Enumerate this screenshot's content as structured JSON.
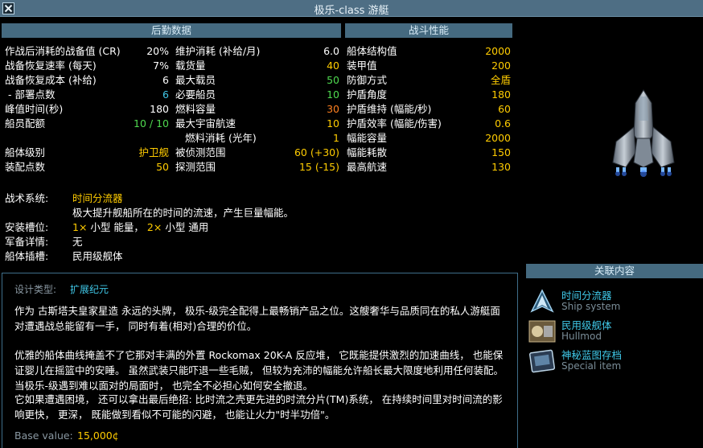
{
  "title": "极乐-class 游艇",
  "logistics": {
    "header": "后勤数据",
    "col1": [
      {
        "label": "作战后消耗的战备值 (CR)",
        "value": "20%",
        "color": "w"
      },
      {
        "label": "战备恢复速率 (每天)",
        "value": "7%",
        "color": "w"
      },
      {
        "label": "战备恢复成本 (补给)",
        "value": "6",
        "color": "w"
      },
      {
        "label": "- 部署点数",
        "value": "6",
        "color": "c"
      },
      {
        "label": "峰值时间(秒)",
        "value": "180",
        "color": "w"
      },
      {
        "label": "船员配额",
        "value": "10 / 10",
        "color": "g"
      },
      {
        "label": "",
        "value": "",
        "color": "w"
      },
      {
        "label": "船体级别",
        "value": "护卫舰",
        "color": "y"
      },
      {
        "label": "装配点数",
        "value": "50",
        "color": "y"
      }
    ],
    "col2": [
      {
        "label": "维护消耗 (补给/月)",
        "value": "6.0",
        "color": "w"
      },
      {
        "label": "载货量",
        "value": "40",
        "color": "y"
      },
      {
        "label": "最大载员",
        "value": "50",
        "color": "g"
      },
      {
        "label": "必要船员",
        "value": "10",
        "color": "g"
      },
      {
        "label": "燃料容量",
        "value": "30",
        "color": "o"
      },
      {
        "label": "最大宇宙航速",
        "value": "10",
        "color": "y"
      },
      {
        "label": "燃料消耗 (光年)",
        "value": "1",
        "color": "y"
      },
      {
        "label": "被侦测范围",
        "value": "60 (+30)",
        "color": "y"
      },
      {
        "label": "探测范围",
        "value": "15 (-15)",
        "color": "y"
      }
    ]
  },
  "combat": {
    "header": "战斗性能",
    "rows": [
      {
        "label": "船体结构值",
        "value": "2000"
      },
      {
        "label": "装甲值",
        "value": "200"
      },
      {
        "label": "防御方式",
        "value": "全盾"
      },
      {
        "label": "护盾角度",
        "value": "180"
      },
      {
        "label": "护盾维持 (幅能/秒)",
        "value": "60"
      },
      {
        "label": "护盾效率 (幅能/伤害)",
        "value": "0.6"
      },
      {
        "label": "幅能容量",
        "value": "2000"
      },
      {
        "label": "幅能耗散",
        "value": "150"
      },
      {
        "label": "最高航速",
        "value": "130"
      }
    ]
  },
  "systems": {
    "tactical_label": "战术系统:",
    "tactical_name": "时间分流器",
    "tactical_desc": "极大提升舰船所在的时间的流速，产生巨量幅能。",
    "slots_label": "安装槽位:",
    "slots_n1": "1×",
    "slots_t1": "小型 能量，",
    "slots_n2": "2×",
    "slots_t2": "小型 通用",
    "armament_label": "军备详情:",
    "armament_value": "无",
    "hullmod_label": "船体插槽:",
    "hullmod_value": "民用级舰体"
  },
  "description": {
    "type_label": "设计类型:",
    "type_value": "扩展纪元",
    "p1": "作为 古斯塔夫皇家星造 永远的头牌， 极乐-级完全配得上最畅销产品之位。这艘奢华与品质同在的私人游艇面对遭遇战总能留有一手， 同时有着(相对)合理的价位。",
    "p2": "优雅的船体曲线掩盖不了它那对丰满的外置 Rockomax 20K-A 反应堆， 它既能提供激烈的加速曲线， 也能保证婴儿在摇篮中的安睡。 虽然武装只能吓退一些毛贼， 但较为充沛的幅能允许船长最大限度地利用任何装配。 当极乐-级遇到难以面对的局面时， 也完全不必担心如何安全撤退。",
    "p3": "它如果遭遇困境， 还可以拿出最后绝招: 比时流之壳更先进的时流分片(TM)系统， 在持续时间里对时间流的影响更快， 更深， 既能做到看似不可能的闪避， 也能让火力\"时半功倍\"。",
    "base_label": "Base value:",
    "base_value": "15,000¢"
  },
  "related": {
    "header": "关联内容",
    "items": [
      {
        "name": "时间分流器",
        "type": "Ship system",
        "icon": "ship-system-icon"
      },
      {
        "name": "民用级舰体",
        "type": "Hullmod",
        "icon": "hullmod-icon"
      },
      {
        "name": "神秘蓝图存档",
        "type": "Special item",
        "icon": "blueprint-icon"
      }
    ]
  },
  "colors": {
    "header_bg": "#456a80",
    "accent_yellow": "#ffcc00",
    "accent_green": "#4fd94f",
    "accent_cyan": "#40c8e8",
    "accent_orange": "#ff8020"
  }
}
